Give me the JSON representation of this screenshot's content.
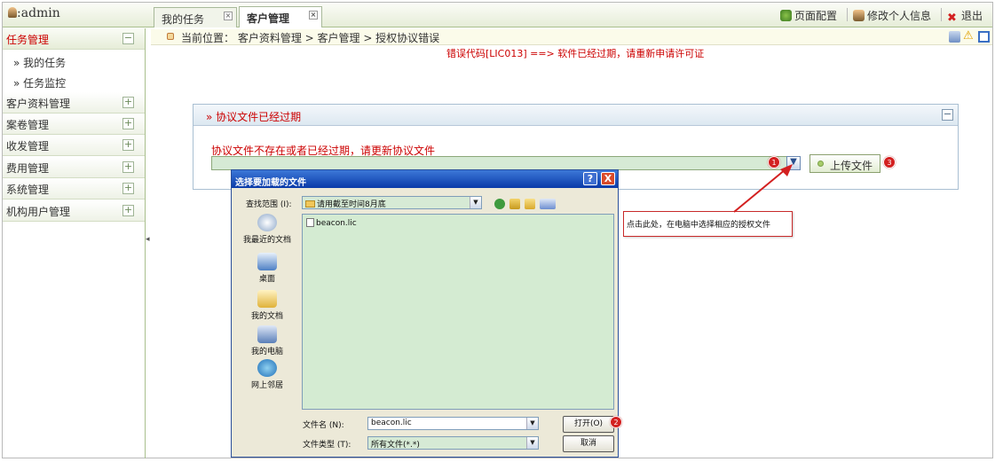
{
  "header": {
    "user": ":admin",
    "tabs": [
      {
        "label": "我的任务",
        "close": "×"
      },
      {
        "label": "客户管理",
        "close": "×"
      }
    ],
    "right_links": {
      "page_config": "页面配置",
      "edit_profile": "修改个人信息",
      "logout": "退出"
    }
  },
  "sidebar": {
    "sections": [
      {
        "label": "任务管理",
        "toggle": "−"
      },
      {
        "label": "客户资料管理",
        "toggle": "+"
      },
      {
        "label": "案卷管理",
        "toggle": "+"
      },
      {
        "label": "收发管理",
        "toggle": "+"
      },
      {
        "label": "费用管理",
        "toggle": "+"
      },
      {
        "label": "系统管理",
        "toggle": "+"
      },
      {
        "label": "机构用户管理",
        "toggle": "+"
      }
    ],
    "sub_items": [
      "» 我的任务",
      "» 任务监控"
    ],
    "collapse_arrow": "◂"
  },
  "breadcrumb": "当前位置：  客户资料管理 > 客户管理 > 授权协议错误",
  "error_text": "错误代码[LIC013] ==> 软件已经过期，请重新申请许可证",
  "panel": {
    "title": "» 协议文件已经过期",
    "message": "协议文件不存在或者已经过期，请更新协议文件",
    "upload_label": "上传文件",
    "collapse": "−"
  },
  "badges": [
    "1",
    "2",
    "3"
  ],
  "dialog": {
    "title": "选择要加载的文件",
    "help": "?",
    "close": "X",
    "look_in_label": "查找范围 (I):",
    "look_in_value": "请用截至时间8月底",
    "places": [
      "我最近的文档",
      "桌面",
      "我的文档",
      "我的电脑",
      "网上邻居"
    ],
    "files": [
      "beacon.lic"
    ],
    "filename_label": "文件名 (N):",
    "filename_value": "beacon.lic",
    "filetype_label": "文件类型 (T):",
    "filetype_value": "所有文件(*.*)",
    "open_label": "打开(O)",
    "cancel_label": "取消"
  },
  "callout_text": "点击此处，在电脑中选择相应的授权文件",
  "colors": {
    "error_red": "#cc0000",
    "badge_red": "#d32020",
    "list_green": "#d4ebd2",
    "dialog_blue": "#0a3aa8"
  }
}
